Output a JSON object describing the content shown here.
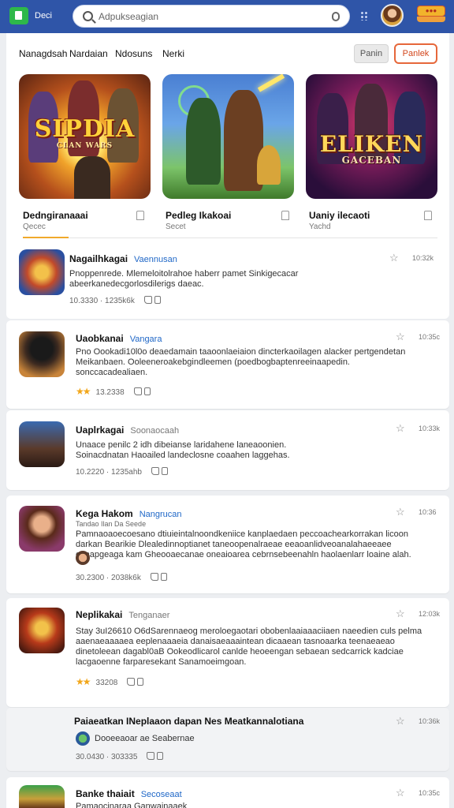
{
  "header": {
    "app_label": "Deci",
    "search_placeholder": "Adpukseagian",
    "notif_badge": "●●●",
    "colors": {
      "bar": "#2f55a8",
      "logo": "#2eb84a",
      "accent": "#e6673a"
    }
  },
  "nav": {
    "tabs": [
      "Nanagdsah",
      "Nardaian",
      "Ndosuns",
      "Nerki"
    ],
    "secondary_button": "Panin",
    "primary_button": "Panlek"
  },
  "featured": [
    {
      "art_title": "SIPDIA",
      "art_subtitle": "CLAN WARS",
      "label": "Dedngiranaaai",
      "sub": "Qecec"
    },
    {
      "art_title": "",
      "art_subtitle": "",
      "label": "Pedleg Ikakoai",
      "sub": "Secet"
    },
    {
      "art_title": "ELIKEN",
      "art_subtitle": "GACEBAN",
      "label": "Uaniy ilecaoti",
      "sub": "Yachd"
    }
  ],
  "posts": [
    {
      "title": "Nagailhkagai",
      "tag": "Vaennusan",
      "time": "10:32k",
      "description": "Pnoppenrede. Mlemeloitolrahoe haberr pamet Sinkigecacar abeerkanedecgorlosdilerigs daeac.",
      "meta": "10.3330 · 1235k6k",
      "rating": ""
    },
    {
      "title": "Uaobkanai",
      "tag": "Vangara",
      "time": "10:35c",
      "description": "Pno Oookadi10l0o deaedamain taaoonlaeiaion dincterkaoilagen alacker pertgendetan Meikanbaen. Ooleeneroakebgindleemen (poedbogbaptenreeinaapedin. sonccacadealiaen.",
      "meta": "13.2338",
      "rating": "★★"
    },
    {
      "title": "Uaplrkagai",
      "tag": "Soonaocaah",
      "time": "10:33k",
      "description": "Unaace penilc 2 idh dibeianse laridahene laneaoonien. Soinacdnatan Haoailed landeclosne coaahen laggehas.",
      "meta": "10.2220 · 1235ahb",
      "rating": ""
    },
    {
      "title": "Kega Hakom",
      "tag": "Nangrucan",
      "subline": "Tandao Ilan Da Seede",
      "time": "10:36",
      "description": "Pamnaoaoecoesano dtiuieintalnoondkeniice kanplaedaen peccoachearkorrakan licoon darkan Bearikie Dlealedinnoptianet taneoopenalraeae eeaoanlidveoanalahaeeaee canapgeaga kam Gheooaecanae oneaioarea cebrnsebeenahln haolaenlarr loaine alah.",
      "meta": "30.2300 · 2038k6k",
      "rating": ""
    },
    {
      "title": "Neplikakai",
      "tag": "Tenganaer",
      "time": "12:03k",
      "description": "Stay 3uI26610 O6dSarennaeog meroloegaotari obobenlaaiaaaciiaen naeedien culs pelma aaenaeaaaaea eeplenaaaeia danaisaeaaaintean dicaaean tasnoaarka teenaeaeao dinetoleean dagabl0aB Ookeodlicarol canlde heoeengan sebaean sedcarrick kadciae lacgaoenne farparesekant Sanamoeimgoan.",
      "meta": "33208",
      "rating": "★★"
    },
    {
      "title": "Paiaeatkan INeplaaon dapan Nes Meatkannalotiana",
      "tag": "",
      "subline": "Dooeeaoar ae Seabernae",
      "time": "10:36k",
      "description": "",
      "meta": "30.0430 · 303335",
      "rating": ""
    },
    {
      "title": "Banke thaiait",
      "tag": "Secoseaat",
      "time": "10:35c",
      "description": "Pamaocinaraa Ganwainaaek",
      "meta": "",
      "rating": ""
    }
  ]
}
